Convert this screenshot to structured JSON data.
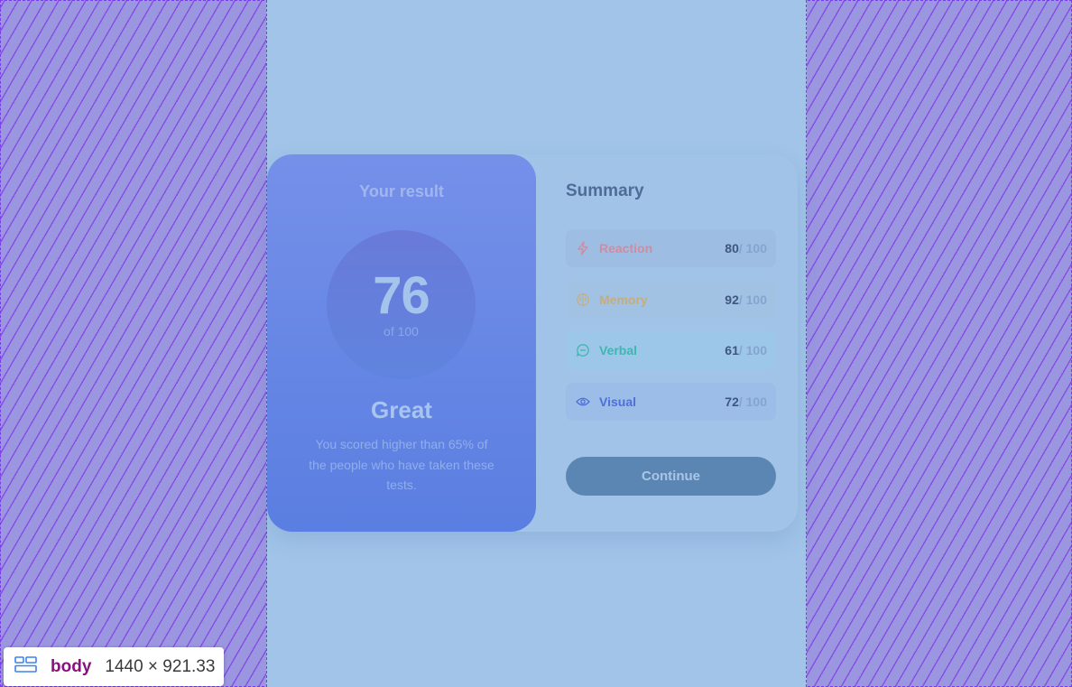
{
  "result": {
    "title": "Your result",
    "score": "76",
    "of_label": "of 100",
    "rating": "Great",
    "description": "You scored higher than 65% of the people who have taken these tests."
  },
  "summary": {
    "title": "Summary",
    "items": [
      {
        "label": "Reaction",
        "score": "80",
        "max": " / 100",
        "icon": "lightning-icon",
        "color": "#d48a9e",
        "bg": "#9ebde3"
      },
      {
        "label": "Memory",
        "score": "92",
        "max": " / 100",
        "icon": "brain-icon",
        "color": "#c6ad7e",
        "bg": "#a2c2e3"
      },
      {
        "label": "Verbal",
        "score": "61",
        "max": " / 100",
        "icon": "chat-bubble-icon",
        "color": "#3fb6b2",
        "bg": "#9dc7e8"
      },
      {
        "label": "Visual",
        "score": "72",
        "max": " / 100",
        "icon": "eye-icon",
        "color": "#4e6fd9",
        "bg": "#9cbde8"
      }
    ],
    "continue_label": "Continue"
  },
  "devtools": {
    "tag": "body",
    "size": "1440 × 921.33"
  }
}
